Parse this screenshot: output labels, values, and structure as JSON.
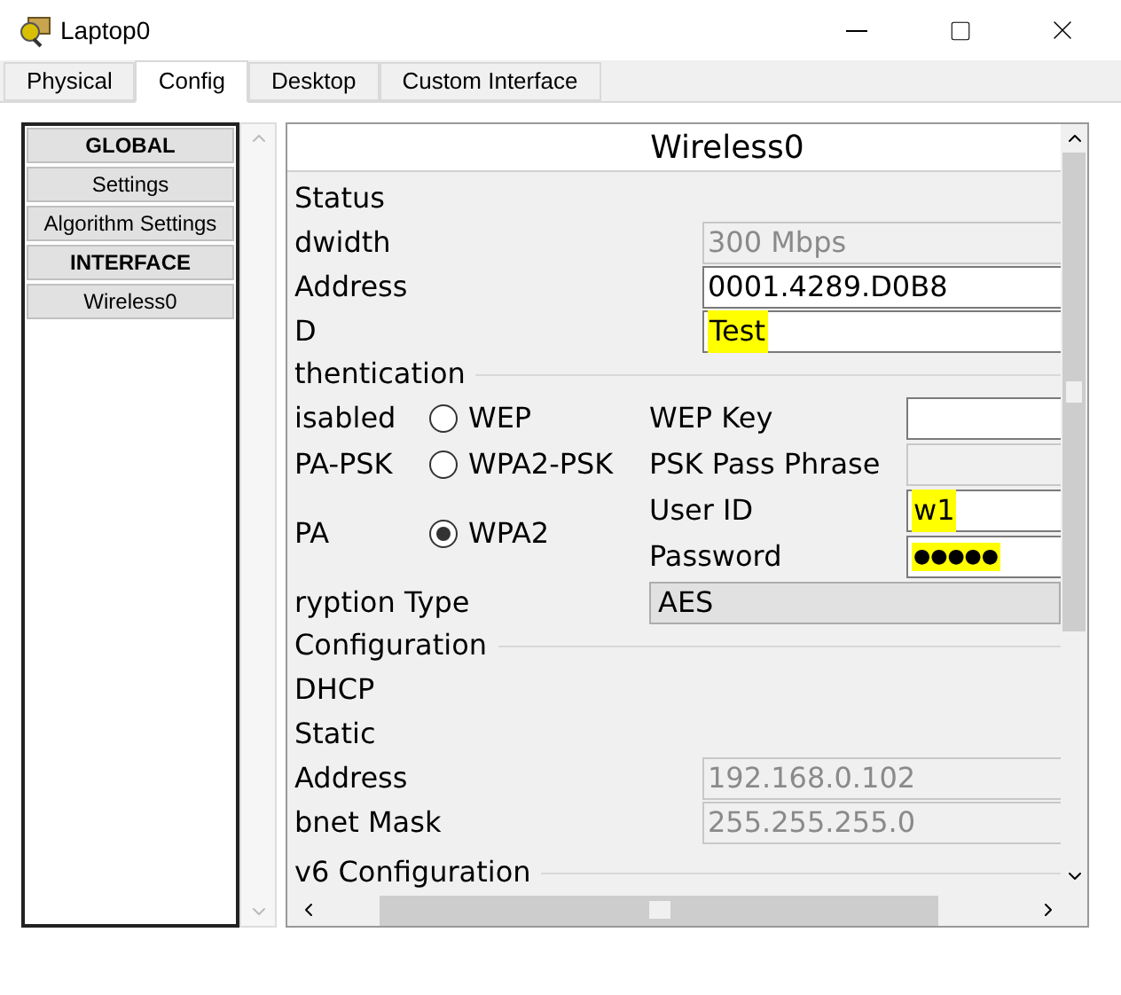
{
  "window": {
    "title": "Laptop0"
  },
  "tabs": [
    {
      "label": "Physical",
      "selected": false
    },
    {
      "label": "Config",
      "selected": true
    },
    {
      "label": "Desktop",
      "selected": false
    },
    {
      "label": "Custom Interface",
      "selected": false
    }
  ],
  "sidebar": {
    "items": [
      {
        "label": "GLOBAL",
        "kind": "header"
      },
      {
        "label": "Settings",
        "kind": "item"
      },
      {
        "label": "Algorithm Settings",
        "kind": "item"
      },
      {
        "label": "INTERFACE",
        "kind": "header"
      },
      {
        "label": "Wireless0",
        "kind": "item"
      }
    ]
  },
  "panel": {
    "title": "Wireless0",
    "port_status": "Status",
    "fields": [
      {
        "label": "dwidth",
        "value": "300 Mbps",
        "disabled": true,
        "highlighted": false
      },
      {
        "label": "Address",
        "value": "0001.4289.D0B8",
        "disabled": false,
        "highlighted": false
      },
      {
        "label": "D",
        "value": "Test",
        "disabled": false,
        "highlighted": true
      }
    ],
    "authentication": {
      "title": "thentication",
      "rows": [
        {
          "cut_option": "isabled",
          "option": {
            "label": "WEP",
            "selected": false
          },
          "field_label": "WEP Key",
          "field": {
            "disabled": false
          }
        },
        {
          "cut_option": "PA-PSK",
          "option": {
            "label": "WPA2-PSK",
            "selected": false
          },
          "field_label": "PSK Pass Phrase",
          "field": {
            "disabled": true
          }
        },
        {
          "cut_option": "PA",
          "option": {
            "label": "WPA2",
            "selected": true
          },
          "field_label": "User ID",
          "field": {
            "value": "w1",
            "disabled": false,
            "highlighted": true
          },
          "field_label_2": "Password",
          "field_2": {
            "value": "●●●●●",
            "disabled": false,
            "highlighted": true
          }
        }
      ]
    },
    "encryption": {
      "label": "ryption Type",
      "value": "AES"
    },
    "ip_configuration": {
      "title": "Configuration",
      "options": [
        "DHCP",
        "Static"
      ],
      "fields": [
        {
          "label": "Address",
          "value": "192.168.0.102",
          "disabled": true
        },
        {
          "label": "bnet Mask",
          "value": "255.255.255.0",
          "disabled": true
        }
      ]
    },
    "ipv6_title": "v6 Configuration"
  }
}
